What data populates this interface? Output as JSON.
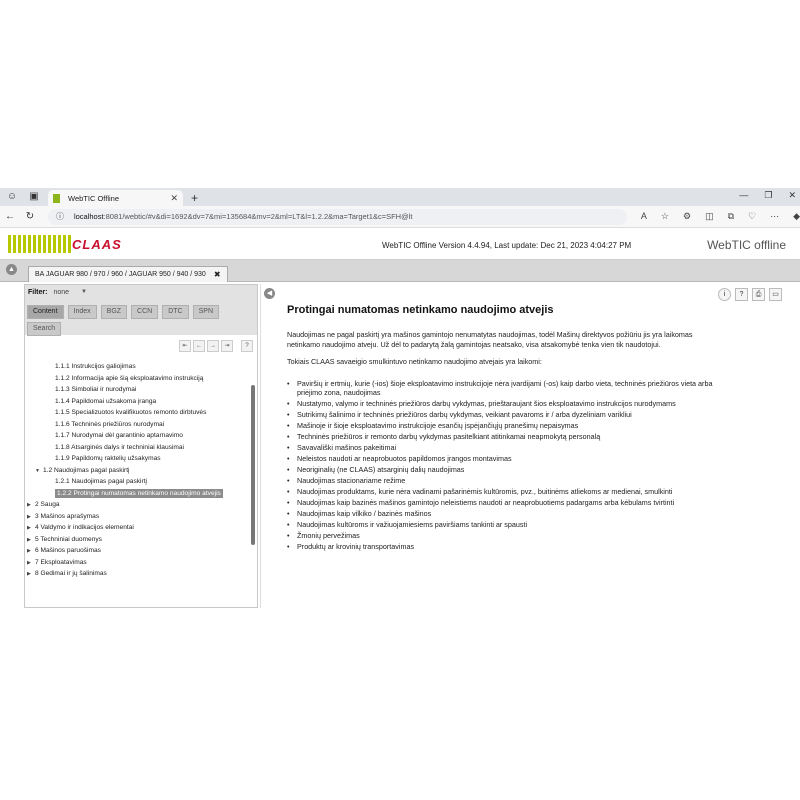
{
  "browser": {
    "tab_title": "WebTIC Offline",
    "url_host": "localhost",
    "url_rest": ":8081/webtic/#v&di=1692&dv=7&mi=135684&mv=2&ml=LT&l=1.2.2&ma=Target1&c=SFH@lt"
  },
  "app": {
    "logo_text": "CLAAS",
    "version_line": "WebTIC Offline Version 4.4.94, Last update: Dec 21, 2023 4:04:27 PM",
    "brand": "WebTIC offline",
    "model_tab": "BA JAGUAR 980 / 970 / 960 / JAGUAR 950 / 940 / 930"
  },
  "left_panel": {
    "filter_label": "Filter:",
    "filter_value": "none",
    "tabs": [
      "Content",
      "Index",
      "BGZ",
      "CCN",
      "DTC",
      "SPN",
      "Search"
    ],
    "tree": [
      {
        "label": "1.1.1 Instrukcijos galiojimas"
      },
      {
        "label": "1.1.2 Informacija apie šią eksploatavimo instrukciją"
      },
      {
        "label": "1.1.3 Simboliai ir nurodymai"
      },
      {
        "label": "1.1.4 Papildomai užsakoma įranga"
      },
      {
        "label": "1.1.5 Specializuotos kvalifikuotos remonto dirbtuvės"
      },
      {
        "label": "1.1.6 Techninės priežiūros nurodymai"
      },
      {
        "label": "1.1.7 Nurodymai dėl garantinio aptarnavimo"
      },
      {
        "label": "1.1.8 Atsarginės dalys ir techniniai klausimai"
      },
      {
        "label": "1.1.9 Papildomų raktelių užsakymas"
      },
      {
        "label": "1.2 Naudojimas pagal paskirtį"
      },
      {
        "label": "1.2.1 Naudojimas pagal paskirtį"
      },
      {
        "label": "1.2.2 Protingai numatomas netinkamo naudojimo atvejis"
      },
      {
        "label": "2 Sauga"
      },
      {
        "label": "3 Mašinos aprašymas"
      },
      {
        "label": "4 Valdymo ir indikacijos elementai"
      },
      {
        "label": "5 Techniniai duomenys"
      },
      {
        "label": "6 Mašinos paruošimas"
      },
      {
        "label": "7 Eksploatavimas"
      },
      {
        "label": "8 Gedimai ir jų šalinimas"
      }
    ]
  },
  "content": {
    "title": "Protingai numatomas netinkamo naudojimo atvejis",
    "para1": "Naudojimas ne pagal paskirtį yra mašinos gamintojo nenumatytas      naudojimas, todėl Mašinų direktyvos požiūriu jis yra laikomas netinkamo naudojimo atveju. Už dėl to padarytą žalą gamintojas neatsako, visa atsakomybė tenka vien tik naudotojui.",
    "para2": "Tokiais CLAAS savaeigio smulkintuvo netinkamo naudojimo atvejais yra laikomi:",
    "list": [
      "Paviršių ir ertmių, kurie (-ios) šioje eksploatavimo instrukcijoje nėra įvardijami (-os) kaip darbo vieta, techninės priežiūros vieta arba priėjimo zona, naudojimas",
      "Nustatymo, valymo ir techninės priežiūros darbų vykdymas, prieštaraujant šios eksploatavimo instrukcijos nurodymams",
      "Sutrikimų šalinimo ir techninės priežiūros darbų vykdymas, veikiant pavaroms ir / arba dyzeliniam varikliui",
      "Mašinoje ir šioje eksploatavimo instrukcijoje esančių įspėjančiųjų pranešimų nepaisymas",
      "Techninės priežiūros ir remonto darbų vykdymas pasitelkiant atitinkamai neapmokytą personalą",
      "Savavališki mašinos pakeitimai",
      "Neleistos naudoti ar neaprobuotos papildomos įrangos montavimas",
      "Neoriginalių (ne CLAAS) atsarginių dalių naudojimas",
      "Naudojimas stacionariame režime",
      "Naudojimas produktams, kurie nėra vadinami pašarinėmis kultūromis, pvz., buitinėms atliekoms ar medienai, smulkinti",
      "Naudojimas kaip bazinės mašinos gamintojo neleistiems naudoti ar neaprobuotiems padargams arba kėbulams tvirtinti",
      "Naudojimas kaip vilkiko / bazinės mašinos",
      "Naudojimas kultūroms ir važiuojamiesiems paviršiams tankinti ar spausti",
      "Žmonių pervežimas",
      "Produktų ar krovinių transportavimas"
    ]
  }
}
